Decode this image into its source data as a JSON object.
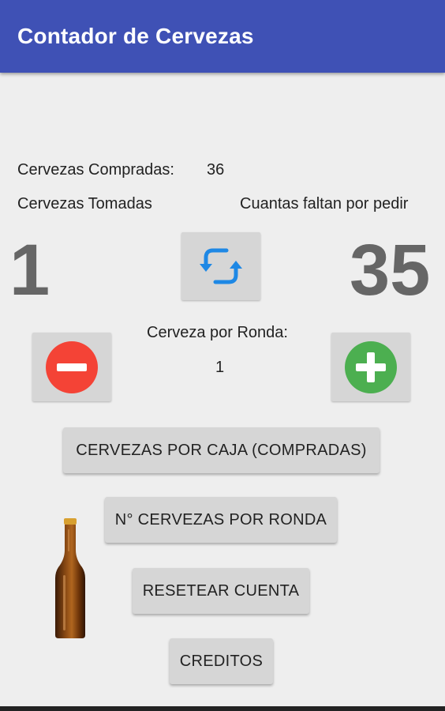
{
  "app": {
    "title": "Contador de Cervezas"
  },
  "purchased": {
    "label": "Cervezas Compradas:",
    "value": "36"
  },
  "taken": {
    "label": "Cervezas Tomadas",
    "value": "1"
  },
  "remaining": {
    "label": "Cuantas faltan por pedir",
    "value": "35"
  },
  "round": {
    "label": "Cerveza por Ronda:",
    "value": "1"
  },
  "buttons": {
    "per_box": "CERVEZAS POR CAJA (COMPRADAS)",
    "per_round": "N° CERVEZAS POR RONDA",
    "reset": "RESETEAR CUENTA",
    "credits": "CREDITOS"
  },
  "icons": {
    "refresh": "refresh-icon",
    "minus": "minus-icon",
    "plus": "plus-icon",
    "bottle": "beer-bottle-icon"
  },
  "colors": {
    "appbar": "#3f51b5",
    "refresh": "#1e88e5",
    "minus": "#f44336",
    "plus": "#4caf50",
    "big_number": "#666666"
  }
}
